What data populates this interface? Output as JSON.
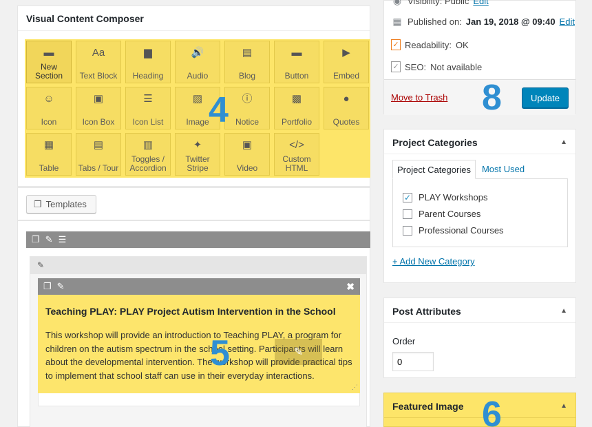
{
  "composer": {
    "title": "Visual Content Composer",
    "blocks": [
      {
        "label": "New Section",
        "icon": "new-section-icon",
        "glyph": "▬"
      },
      {
        "label": "Text Block",
        "icon": "text-block-icon",
        "glyph": "Aa"
      },
      {
        "label": "Heading",
        "icon": "heading-icon",
        "glyph": "▆"
      },
      {
        "label": "Audio",
        "icon": "audio-icon",
        "glyph": "🔊"
      },
      {
        "label": "Blog",
        "icon": "blog-icon",
        "glyph": "▤"
      },
      {
        "label": "Button",
        "icon": "button-icon",
        "glyph": "▬"
      },
      {
        "label": "Embed",
        "icon": "embed-icon",
        "glyph": "▶"
      },
      {
        "label": "Icon",
        "icon": "smiley-icon",
        "glyph": "☺"
      },
      {
        "label": "Icon Box",
        "icon": "clipboard-icon",
        "glyph": "▣"
      },
      {
        "label": "Icon List",
        "icon": "list-icon",
        "glyph": "☰"
      },
      {
        "label": "Image",
        "icon": "image-icon",
        "glyph": "▨"
      },
      {
        "label": "Notice",
        "icon": "info-icon",
        "glyph": "ⓘ"
      },
      {
        "label": "Portfolio",
        "icon": "portfolio-icon",
        "glyph": "▩"
      },
      {
        "label": "Quotes",
        "icon": "speech-bubble-icon",
        "glyph": "●"
      },
      {
        "label": "Table",
        "icon": "table-icon",
        "glyph": "▦"
      },
      {
        "label": "Tabs / Tour",
        "icon": "tabs-icon",
        "glyph": "▤"
      },
      {
        "label": "Toggles / Accordion",
        "icon": "accordion-icon",
        "glyph": "▥"
      },
      {
        "label": "Twitter Stripe",
        "icon": "twitter-icon",
        "glyph": "✦"
      },
      {
        "label": "Video",
        "icon": "video-icon",
        "glyph": "▣"
      },
      {
        "label": "Custom HTML",
        "icon": "code-icon",
        "glyph": "</>"
      }
    ],
    "templates_label": "Templates"
  },
  "builder": {
    "notice_title": "Teaching PLAY: PLAY Project Autism Intervention in the School",
    "notice_text": "This workshop will provide an introduction to Teaching PLAY, a program for children on the autism spectrum in the school setting. Participants will learn about the developmental intervention. The workshop will provide practical tips to implement that school staff can use in their everyday interactions."
  },
  "callouts": {
    "composer": "4",
    "builder": "5",
    "featured": "6",
    "publish": "8"
  },
  "publish": {
    "visibility_text": "Visibility: Public",
    "visibility_edit": "Edit",
    "published_label": "Published on:",
    "published_date": "Jan 19, 2018 @ 09:40",
    "published_edit": "Edit",
    "readability_label": "Readability:",
    "readability_value": "OK",
    "seo_label": "SEO:",
    "seo_value": "Not available",
    "trash_label": "Move to Trash",
    "update_label": "Update"
  },
  "categories": {
    "title": "Project Categories",
    "tab_all": "Project Categories",
    "tab_used": "Most Used",
    "items": [
      {
        "label": "PLAY Workshops",
        "checked": "✓"
      },
      {
        "label": "Parent Courses",
        "checked": ""
      },
      {
        "label": "Professional Courses",
        "checked": ""
      }
    ],
    "add_new": "+ Add New Category"
  },
  "attributes": {
    "title": "Post Attributes",
    "order_label": "Order",
    "order_value": "0"
  },
  "featured": {
    "title": "Featured Image"
  },
  "colors": {
    "highlight": "#fde569",
    "callout": "#2f8fd2",
    "update_button": "#0085ba",
    "trash": "#aa0000",
    "link": "#0073aa"
  }
}
